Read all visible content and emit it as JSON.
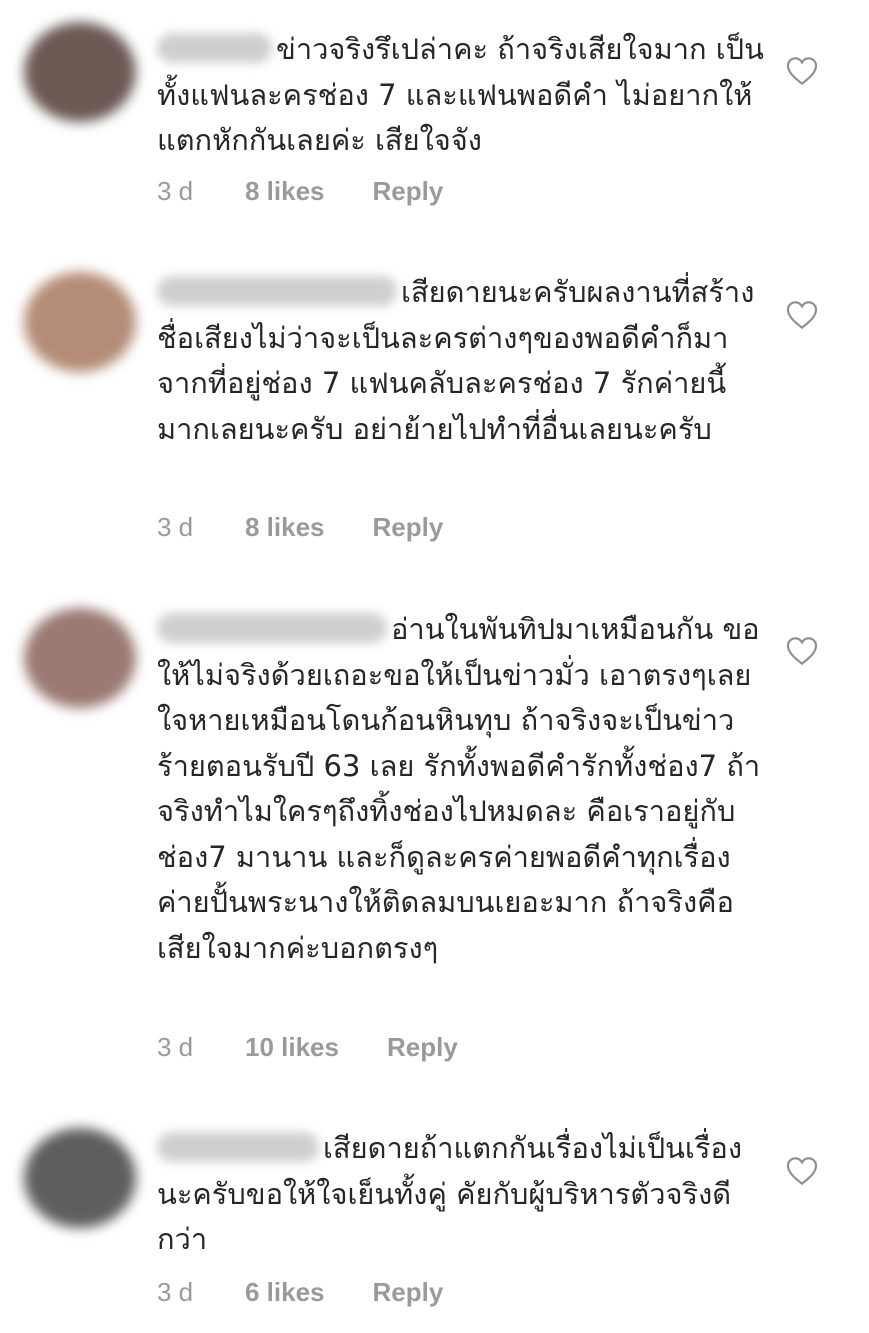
{
  "comments": [
    {
      "text": "ข่าวจริงรึเปล่าคะ ถ้าจริงเสียใจมาก เป็นทั้งแฟนละครช่อง 7 และแฟนพอดีคำ ไม่อยากให้แตกหักกันเลยค่ะ เสียใจจัง",
      "time": "3 d",
      "likes": "8 likes",
      "reply": "Reply",
      "avatar_color": "#6b5a54",
      "like_icon": "heart-outline-icon"
    },
    {
      "text": "เสียดายนะครับผลงานที่สร้างชื่อเสียงไม่ว่าจะเป็นละครต่างๆของพอดีคำก็มาจากที่อยู่ช่อง 7 แฟนคลับละครช่อง 7 รักค่ายนี้มากเลยนะครับ อย่าย้ายไปทำที่อื่นเลยนะครับ",
      "time": "3 d",
      "likes": "8 likes",
      "reply": "Reply",
      "avatar_color": "#b58c78",
      "like_icon": "heart-outline-icon"
    },
    {
      "text": "อ่านในพันทิปมาเหมือนกัน ขอให้ไม่จริงด้วยเถอะขอให้เป็นข่าวมั่ว เอาตรงๆเลยใจหายเหมือนโดนก้อนหินทุบ ถ้าจริงจะเป็นข่าวร้ายตอนรับปี 63 เลย รักทั้งพอดีคำรักทั้งช่อง7 ถ้าจริงทำไมใครๆถึงทิ้งช่องไปหมดละ คือเราอยู่กับช่อง7 มานาน และก็ดูละครค่ายพอดีคำทุกเรื่อง ค่ายปั้นพระนางให้ติดลมบนเยอะมาก ถ้าจริงคือเสียใจมากค่ะบอกตรงๆ",
      "time": "3 d",
      "likes": "10 likes",
      "reply": "Reply",
      "avatar_color": "#9a7a72",
      "like_icon": "heart-outline-icon"
    },
    {
      "text": "เสียดายถ้าแตกกันเรื่องไม่เป็นเรื่องนะครับขอให้ใจเย็นทั้งคู่ คัยกับผู้บริหารตัวจริงดีกว่า",
      "time": "3 d",
      "likes": "6 likes",
      "reply": "Reply",
      "avatar_color": "#5e5e5e",
      "like_icon": "heart-outline-icon"
    }
  ]
}
